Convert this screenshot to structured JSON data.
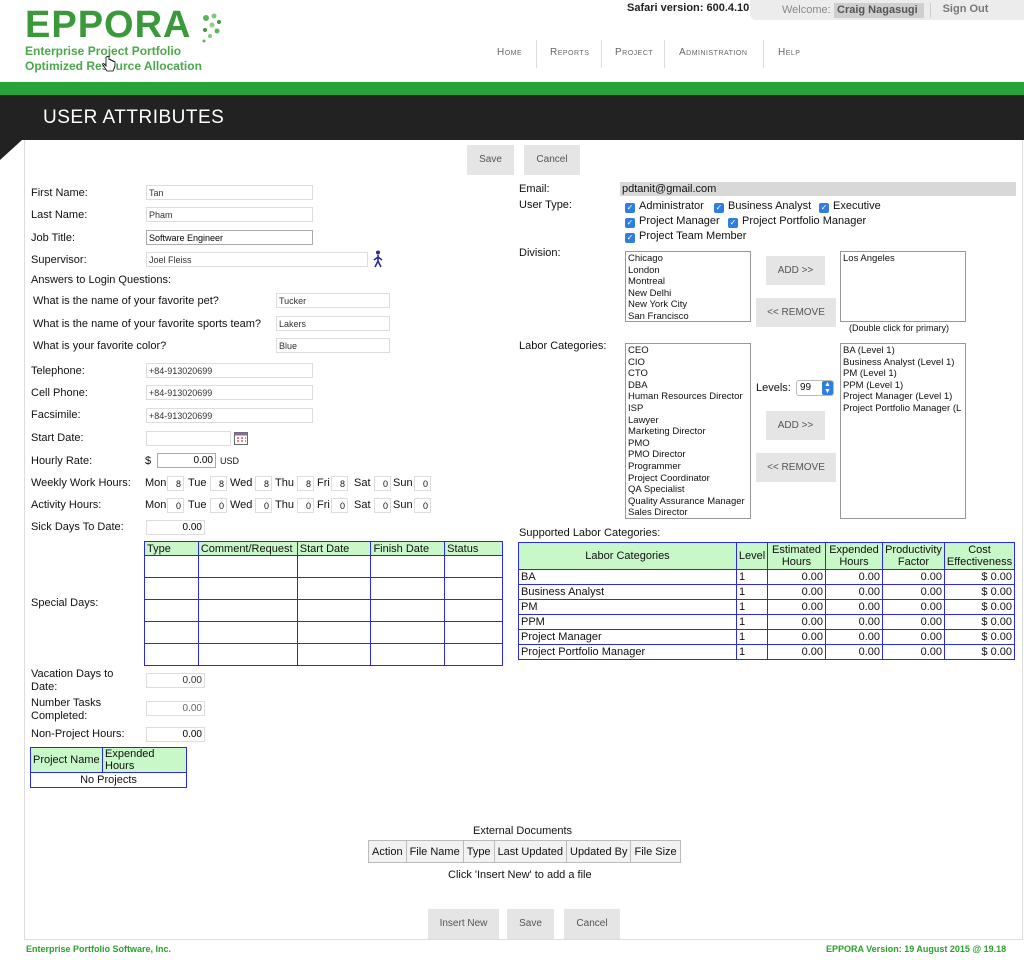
{
  "header": {
    "logo_text": "EPPORA",
    "tagline_1": "Enterprise Project Portfolio",
    "tagline_2": "Optimized Resource Allocation",
    "safari_version": "Safari version: 600.4.10",
    "welcome_label": "Welcome:",
    "user_name": "Craig Nagasugi",
    "sign_out": "Sign Out",
    "nav": [
      "Home",
      "Reports",
      "Project",
      "Administration",
      "Help"
    ]
  },
  "page_title": "USER ATTRIBUTES",
  "toolbar": {
    "save_label": "Save",
    "cancel_label": "Cancel"
  },
  "form": {
    "first_name_label": "First Name:",
    "first_name": "Tan",
    "last_name_label": "Last Name:",
    "last_name": "Pham",
    "job_title_label": "Job Title:",
    "job_title": "Software Engineer",
    "supervisor_label": "Supervisor:",
    "supervisor": "Joel Fleiss",
    "login_questions_label": "Answers to Login Questions:",
    "q1": "What is the name of your favorite pet?",
    "a1": "Tucker",
    "q2": "What is the name of your favorite sports team?",
    "a2": "Lakers",
    "q3": "What is your favorite color?",
    "a3": "Blue",
    "telephone_label": "Telephone:",
    "telephone": "+84-913020699",
    "cell_label": "Cell Phone:",
    "cell": "+84-913020699",
    "fax_label": "Facsimile:",
    "fax": "+84-913020699",
    "start_date_label": "Start Date:",
    "start_date": "",
    "hourly_rate_label": "Hourly Rate:",
    "currency_symbol": "$",
    "hourly_rate": "0.00",
    "currency": "USD",
    "weekly_hours_label": "Weekly Work Hours:",
    "activity_hours_label": "Activity Hours:",
    "days": [
      "Mon",
      "Tue",
      "Wed",
      "Thu",
      "Fri",
      "Sat",
      "Sun"
    ],
    "weekly_hours": [
      "8",
      "8",
      "8",
      "8",
      "8",
      "0",
      "0"
    ],
    "activity_hours": [
      "0",
      "0",
      "0",
      "0",
      "0",
      "0",
      "0"
    ],
    "sick_days_label": "Sick Days To Date:",
    "sick_days": "0.00",
    "special_days_label": "Special Days:",
    "special_days_headers": [
      "Type",
      "Comment/Request",
      "Start Date",
      "Finish Date",
      "Status"
    ],
    "vacation_label_1": "Vacation Days to",
    "vacation_label_2": "Date:",
    "vacation_days": "0.00",
    "tasks_label_1": "Number Tasks",
    "tasks_label_2": "Completed:",
    "tasks_completed": "0.00",
    "non_project_label": "Non-Project Hours:",
    "non_project_hours": "0.00",
    "projects_headers": [
      "Project Name",
      "Expended Hours"
    ],
    "no_projects": "No Projects"
  },
  "right": {
    "email_label": "Email:",
    "email": "pdtanit@gmail.com",
    "user_type_label": "User Type:",
    "user_types": [
      "Administrator",
      "Business Analyst",
      "Executive",
      "Project Manager",
      "Project Portfolio Manager",
      "Project Team Member"
    ],
    "division_label": "Division:",
    "divisions": [
      "Chicago",
      "London",
      "Montreal",
      "New Delhi",
      "New York City",
      "San Francisco"
    ],
    "selected_divisions": [
      "Los Angeles"
    ],
    "add_label": "ADD >>",
    "remove_label": "<< REMOVE",
    "primary_hint": "(Double click for primary)",
    "labor_label": "Labor Categories:",
    "labor_categories": [
      "CEO",
      "CIO",
      "CTO",
      "DBA",
      "Human Resources Director",
      "ISP",
      "Lawyer",
      "Marketing Director",
      "PMO",
      "PMO Director",
      "Programmer",
      "Project Coordinator",
      "QA Specialist",
      "Quality Assurance Manager",
      "Sales Director"
    ],
    "levels_label": "Levels:",
    "levels_value": "99",
    "selected_labor": [
      "BA (Level 1)",
      "Business Analyst (Level 1)",
      "PM (Level 1)",
      "PPM (Level 1)",
      "Project Manager (Level 1)",
      "Project Portfolio Manager (L"
    ],
    "supported_label": "Supported Labor Categories:",
    "supported_headers": [
      "Labor Categories",
      "Level",
      "Estimated Hours",
      "Expended Hours",
      "Productivity Factor",
      "Cost Effectiveness"
    ],
    "supported_rows": [
      [
        "BA",
        "1",
        "0.00",
        "0.00",
        "0.00",
        "$ 0.00"
      ],
      [
        "Business Analyst",
        "1",
        "0.00",
        "0.00",
        "0.00",
        "$ 0.00"
      ],
      [
        "PM",
        "1",
        "0.00",
        "0.00",
        "0.00",
        "$ 0.00"
      ],
      [
        "PPM",
        "1",
        "0.00",
        "0.00",
        "0.00",
        "$ 0.00"
      ],
      [
        "Project Manager",
        "1",
        "0.00",
        "0.00",
        "0.00",
        "$ 0.00"
      ],
      [
        "Project Portfolio Manager",
        "1",
        "0.00",
        "0.00",
        "0.00",
        "$ 0.00"
      ]
    ]
  },
  "external": {
    "title": "External Documents",
    "headers": [
      "Action",
      "File Name",
      "Type",
      "Last Updated",
      "Updated By",
      "File Size"
    ],
    "hint": "Click 'Insert New' to add a file",
    "insert_label": "Insert New",
    "save_label": "Save",
    "cancel_label": "Cancel"
  },
  "footer": {
    "company": "Enterprise Portfolio Software, Inc.",
    "version": "EPPORA Version: 19 August 2015 @ 19.18"
  },
  "colors": {
    "brand_green": "#27a33a",
    "header_dark": "#222222",
    "table_border": "#2a2ae0",
    "table_header": "#c8f7c8",
    "checkbox_blue": "#2f7fe0"
  }
}
